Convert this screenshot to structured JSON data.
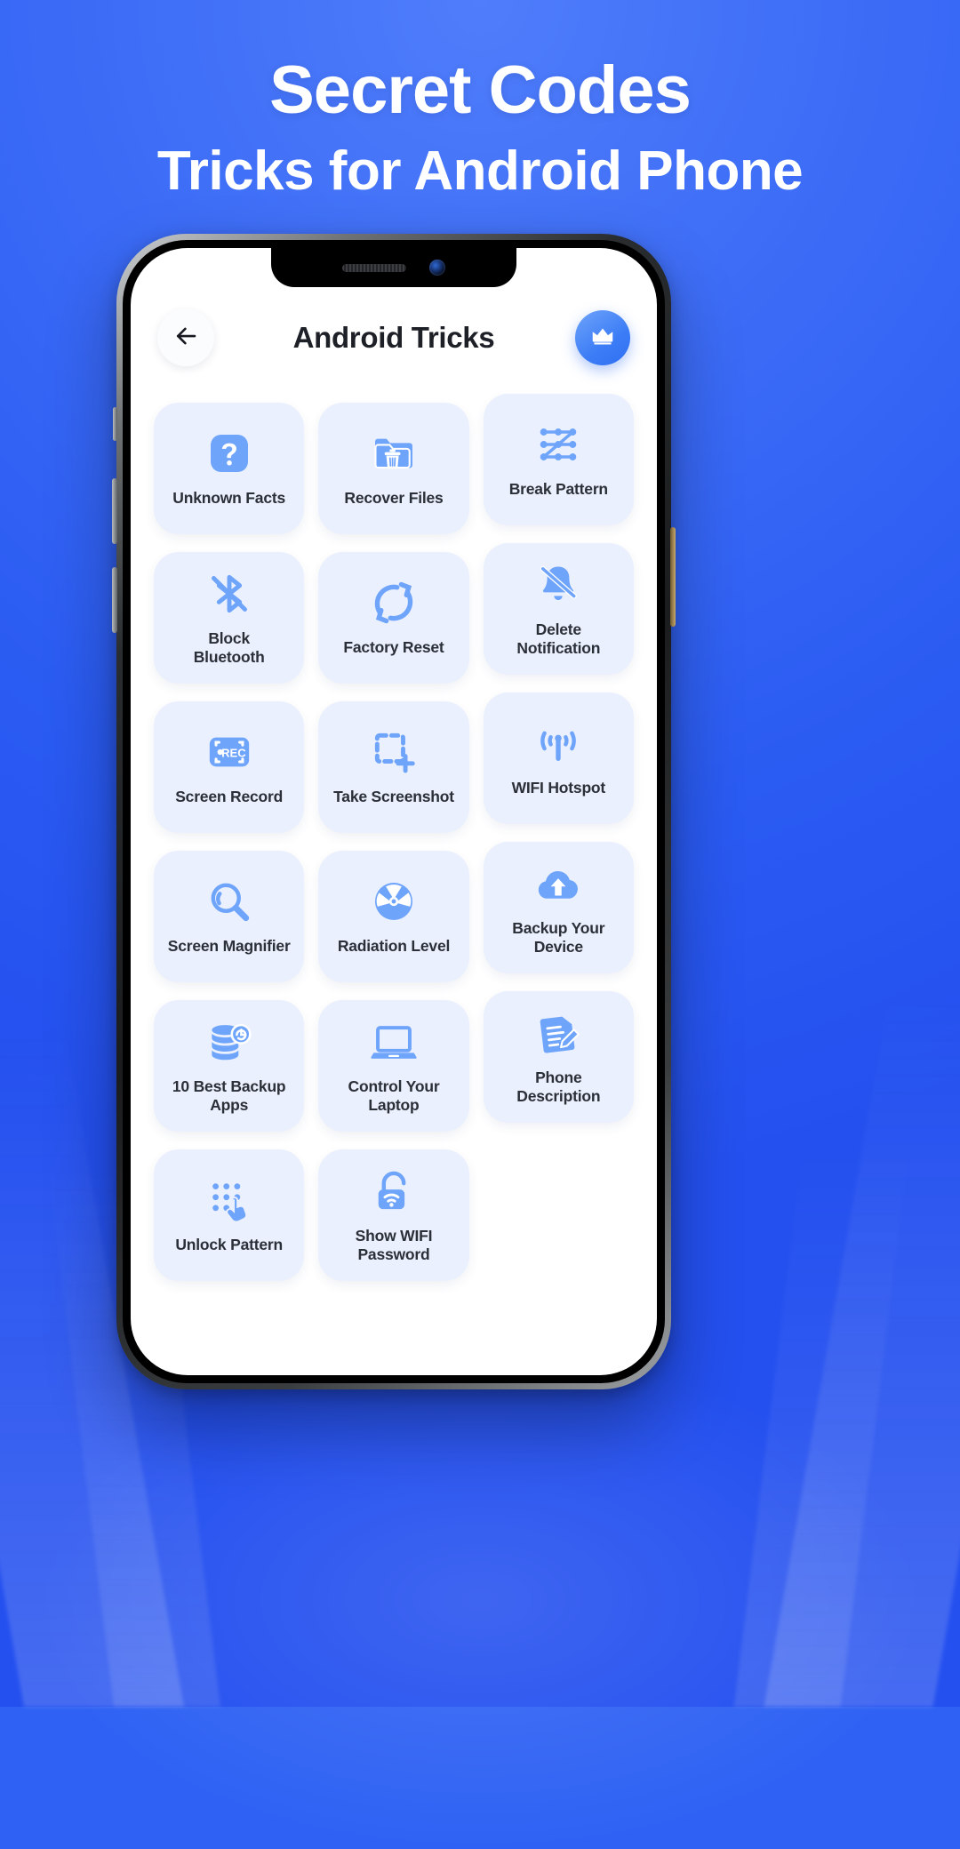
{
  "promo": {
    "line1": "Secret Codes",
    "line2": "Tricks for Android Phone"
  },
  "colors": {
    "background_start": "#4f7dfb",
    "background_end": "#2450ef",
    "tile_background": "#eaf0fd",
    "icon_blue": "#6fa4fb",
    "accent_blue": "#3c7df6",
    "label_text": "#2b2f38",
    "title_text": "#1d2026",
    "screen_background": "#ffffff"
  },
  "phone": {
    "notch": {
      "speaker_icon": "speaker-grille",
      "camera_icon": "front-camera"
    }
  },
  "app": {
    "appbar": {
      "back_icon": "arrow-left-icon",
      "title": "Android Tricks",
      "premium_icon": "crown-icon"
    },
    "grid": {
      "items": [
        {
          "label": "Unknown Facts",
          "icon": "question-mark-icon"
        },
        {
          "label": "Recover Files",
          "icon": "folder-trash-icon"
        },
        {
          "label": "Break Pattern",
          "icon": "pattern-lock-icon"
        },
        {
          "label": "Block\nBluetooth",
          "icon": "bluetooth-off-icon"
        },
        {
          "label": "Factory Reset",
          "icon": "refresh-cycle-icon"
        },
        {
          "label": "Delete\nNotification",
          "icon": "bell-off-icon"
        },
        {
          "label": "Screen Record",
          "icon": "rec-frame-icon"
        },
        {
          "label": "Take Screenshot",
          "icon": "screenshot-crop-icon"
        },
        {
          "label": "WIFI Hotspot",
          "icon": "hotspot-broadcast-icon"
        },
        {
          "label": "Screen Magnifier",
          "icon": "magnifier-icon"
        },
        {
          "label": "Radiation Level",
          "icon": "radiation-icon"
        },
        {
          "label": "Backup Your\nDevice",
          "icon": "cloud-upload-icon"
        },
        {
          "label": "10 Best Backup\nApps",
          "icon": "database-restore-icon"
        },
        {
          "label": "Control Your\nLaptop",
          "icon": "laptop-icon"
        },
        {
          "label": "Phone\nDescription",
          "icon": "document-edit-icon"
        },
        {
          "label": "Unlock Pattern",
          "icon": "dots-tap-icon"
        },
        {
          "label": "Show WIFI\nPassword",
          "icon": "wifi-lock-icon"
        }
      ]
    }
  }
}
